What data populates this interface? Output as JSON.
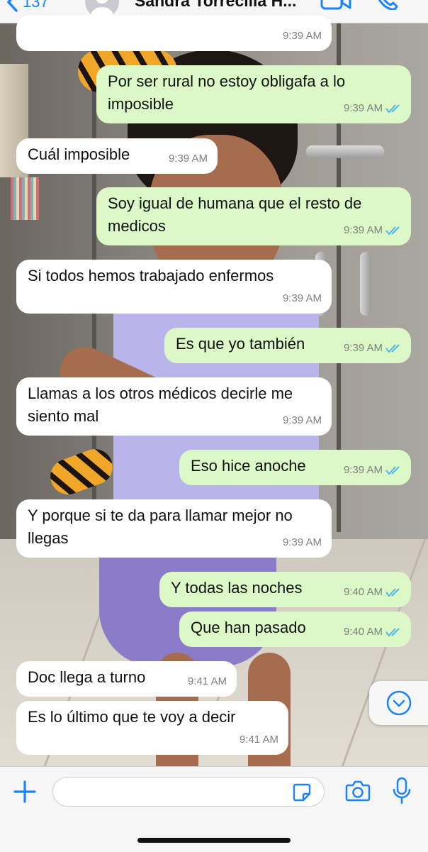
{
  "header": {
    "back_count": "137",
    "contact_name": "Sandra Torrecilla H...",
    "icons": {
      "back": "chevron-left-icon",
      "avatar": "person-avatar-icon",
      "video": "video-camera-icon",
      "call": "phone-icon"
    }
  },
  "messages": [
    {
      "direction": "in",
      "text": "",
      "time": "9:39 AM"
    },
    {
      "direction": "out",
      "text": "Por ser rural no estoy obligafa a lo imposible",
      "time": "9:39 AM",
      "status": "read"
    },
    {
      "direction": "in",
      "text": "Cuál imposible",
      "time": "9:39 AM"
    },
    {
      "direction": "out",
      "text": "Soy igual de humana que el resto de medicos",
      "time": "9:39 AM",
      "status": "read"
    },
    {
      "direction": "in",
      "text": "Si todos hemos trabajado enfermos",
      "time": "9:39 AM"
    },
    {
      "direction": "out",
      "text": "Es que yo también",
      "time": "9:39 AM",
      "status": "read"
    },
    {
      "direction": "in",
      "text": "Llamas a los otros médicos decirle me siento mal",
      "time": "9:39 AM"
    },
    {
      "direction": "out",
      "text": "Eso hice anoche",
      "time": "9:39 AM",
      "status": "read"
    },
    {
      "direction": "in",
      "text": "Y porque si te da para llamar mejor no llegas",
      "time": "9:39 AM"
    },
    {
      "direction": "out",
      "text": "Y todas las noches",
      "time": "9:40 AM",
      "status": "read"
    },
    {
      "direction": "out",
      "text": "Que han pasado",
      "time": "9:40 AM",
      "status": "read"
    },
    {
      "direction": "in",
      "text": "Doc llega a turno",
      "time": "9:41 AM"
    },
    {
      "direction": "in",
      "text": "Es lo último que te voy a decir",
      "time": "9:41 AM"
    }
  ],
  "input_bar": {
    "text_value": "",
    "placeholder": "",
    "icons": {
      "add": "plus-icon",
      "sticker": "sticker-icon",
      "camera": "camera-icon",
      "mic": "microphone-icon"
    }
  },
  "scroll_button": {
    "icon": "chevron-down-circle-icon"
  },
  "colors": {
    "incoming_bubble": "#ffffff",
    "outgoing_bubble": "#dcf8c6",
    "accent": "#1a84ff",
    "read_ticks": "#4fb6ec"
  }
}
